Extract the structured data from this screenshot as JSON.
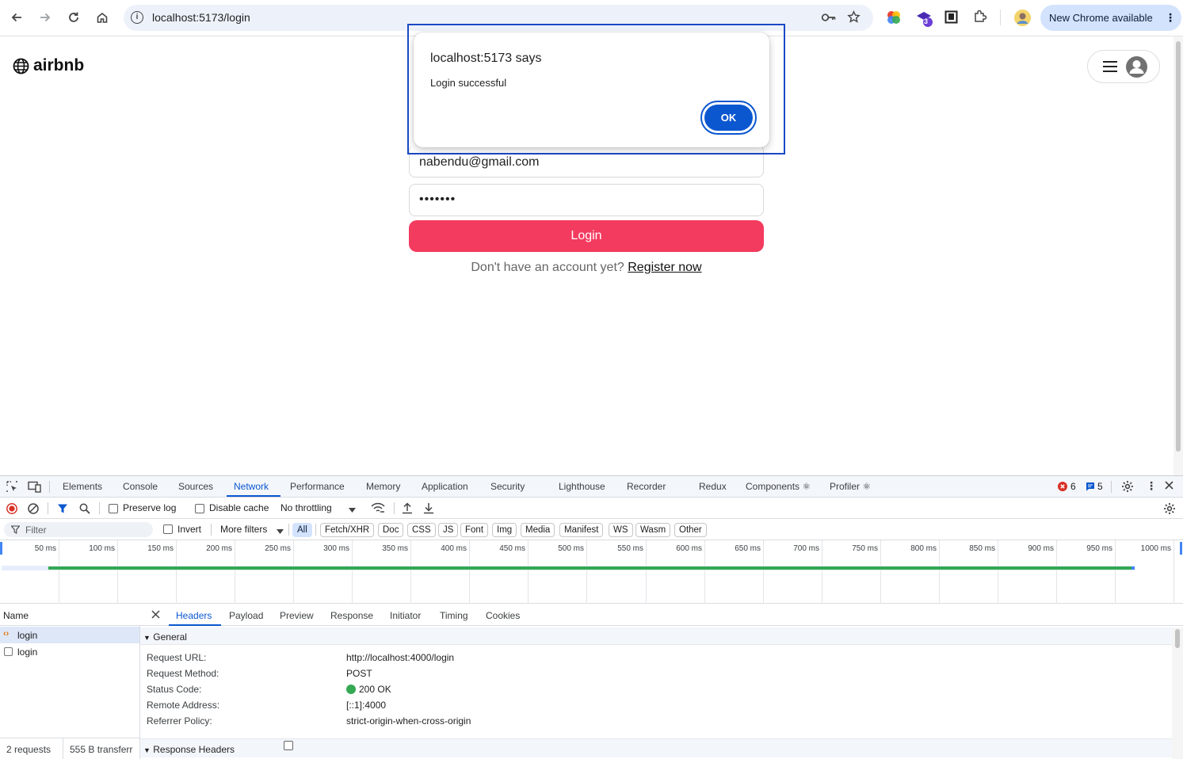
{
  "browser": {
    "url": "localhost:5173/login",
    "update_button": "New Chrome available",
    "extension_badge": "3"
  },
  "page": {
    "brand": "airbnb",
    "email_value": "nabendu@gmail.com",
    "password_value": "•••••••",
    "login_button": "Login",
    "register_prompt": "Don't have an account yet?",
    "register_link": "Register now"
  },
  "alert": {
    "title": "localhost:5173 says",
    "message": "Login successful",
    "ok_label": "OK"
  },
  "devtools": {
    "tabs": [
      "Elements",
      "Console",
      "Sources",
      "Network",
      "Performance",
      "Memory",
      "Application",
      "Security",
      "Lighthouse",
      "Recorder",
      "Redux",
      "Components ⚛",
      "Profiler ⚛"
    ],
    "active_tab": "Network",
    "error_count": "6",
    "message_count": "5",
    "preserve_log": "Preserve log",
    "disable_cache": "Disable cache",
    "throttling": "No throttling",
    "filter_placeholder": "Filter",
    "invert": "Invert",
    "more_filters": "More filters",
    "type_filters": [
      "All",
      "Fetch/XHR",
      "Doc",
      "CSS",
      "JS",
      "Font",
      "Img",
      "Media",
      "Manifest",
      "WS",
      "Wasm",
      "Other"
    ],
    "active_type_filter": "All",
    "timeline_ticks": [
      "50 ms",
      "100 ms",
      "150 ms",
      "200 ms",
      "250 ms",
      "300 ms",
      "350 ms",
      "400 ms",
      "450 ms",
      "500 ms",
      "550 ms",
      "600 ms",
      "650 ms",
      "700 ms",
      "750 ms",
      "800 ms",
      "850 ms",
      "900 ms",
      "950 ms",
      "1000 ms"
    ],
    "name_header": "Name",
    "requests": [
      {
        "name": "login",
        "selected": true
      },
      {
        "name": "login",
        "selected": false
      }
    ],
    "footer_requests": "2 requests",
    "footer_transfer": "555 B transferr",
    "detail_tabs": [
      "Headers",
      "Payload",
      "Preview",
      "Response",
      "Initiator",
      "Timing",
      "Cookies"
    ],
    "active_detail_tab": "Headers",
    "general_section": "General",
    "general": [
      {
        "key": "Request URL:",
        "value": "http://localhost:4000/login"
      },
      {
        "key": "Request Method:",
        "value": "POST"
      },
      {
        "key": "Status Code:",
        "value": "200 OK"
      },
      {
        "key": "Remote Address:",
        "value": "[::1]:4000"
      },
      {
        "key": "Referrer Policy:",
        "value": "strict-origin-when-cross-origin"
      }
    ],
    "response_headers_section": "Response Headers",
    "colors": {
      "accent": "#0b57d0",
      "status_ok": "#34a853",
      "error": "#d93025"
    }
  }
}
